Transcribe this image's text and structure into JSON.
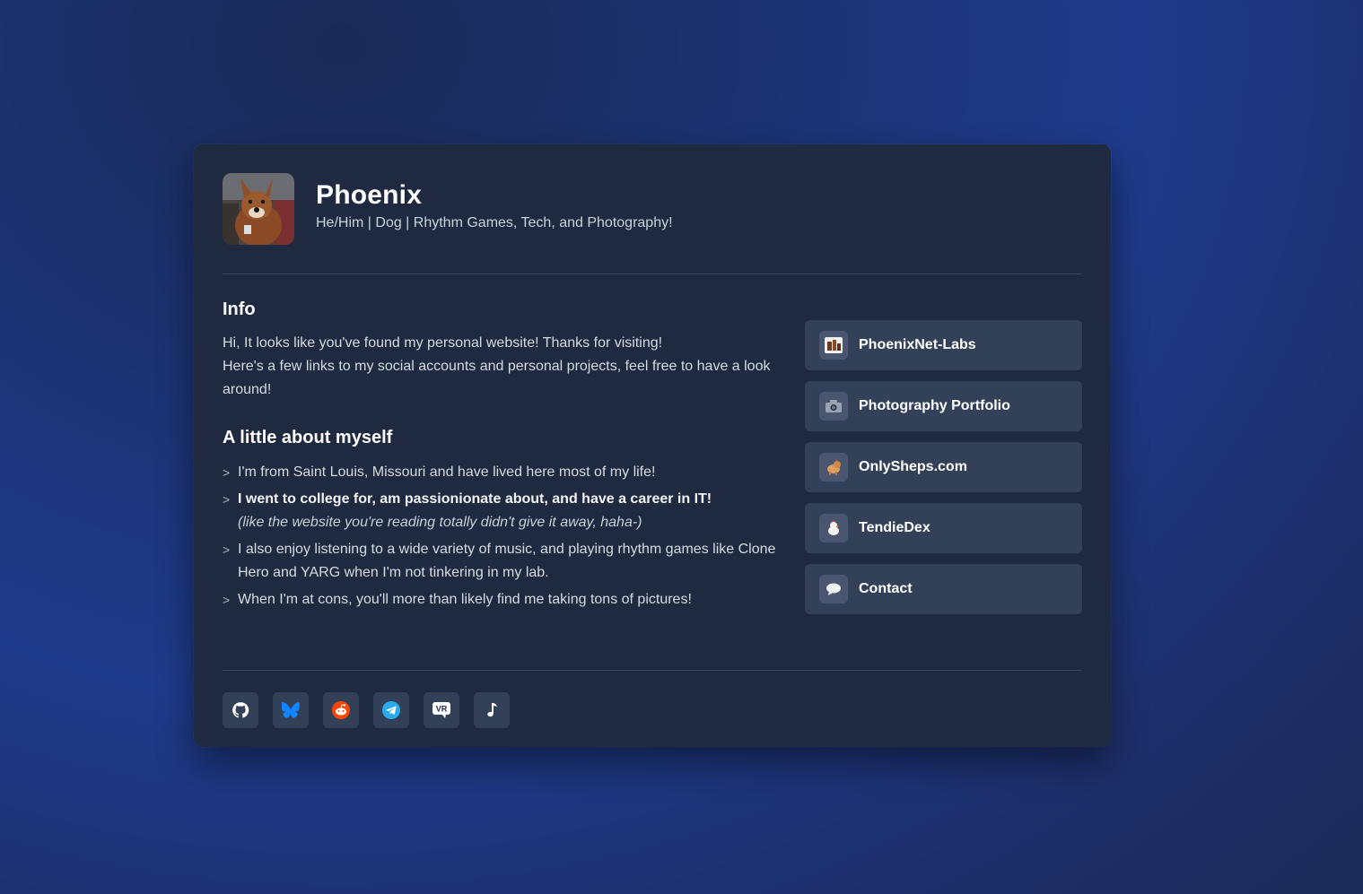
{
  "profile": {
    "name": "Phoenix",
    "tagline": "He/Him | Dog | Rhythm Games, Tech, and Photography!"
  },
  "info": {
    "title": "Info",
    "line1": "Hi, It looks like you've found my personal website! Thanks for visiting!",
    "line2": "Here's a few links to my social accounts and personal projects, feel free to have a look around!"
  },
  "about": {
    "title": "A little about myself",
    "items": [
      {
        "text": "I'm from Saint Louis, Missouri and have lived here most of my life!"
      },
      {
        "bold": "I went to college for, am passionionate about, and have a career in IT!",
        "italic": "(like the website you're reading totally didn't give it away, haha-)"
      },
      {
        "text": "I also enjoy listening to a wide variety of music, and playing rhythm games like Clone Hero and YARG when I'm not tinkering in my lab."
      },
      {
        "text": "When I'm at cons, you'll more than likely find me taking tons of pictures!"
      }
    ]
  },
  "links": [
    {
      "label": "PhoenixNet-Labs",
      "icon": "server-rack-icon"
    },
    {
      "label": "Photography Portfolio",
      "icon": "camera-icon"
    },
    {
      "label": "OnlySheps.com",
      "icon": "dog-icon"
    },
    {
      "label": "TendieDex",
      "icon": "chicken-icon"
    },
    {
      "label": "Contact",
      "icon": "speech-bubble-icon"
    }
  ],
  "socials": [
    {
      "icon": "github-icon",
      "color": "#ffffff"
    },
    {
      "icon": "bluesky-icon",
      "color": "#1185fe"
    },
    {
      "icon": "reddit-icon",
      "color": "#ff4500"
    },
    {
      "icon": "telegram-icon",
      "color": "#2aabee"
    },
    {
      "icon": "vrchat-icon",
      "color": "#ffffff"
    },
    {
      "icon": "music-note-icon",
      "color": "#ffffff"
    }
  ]
}
